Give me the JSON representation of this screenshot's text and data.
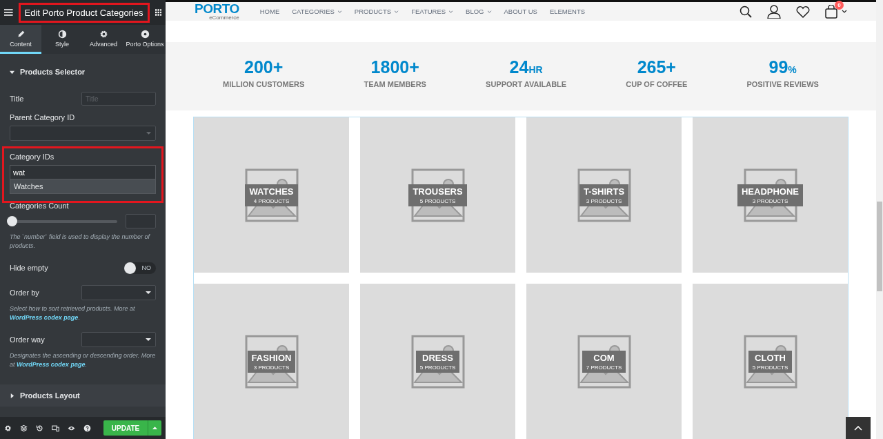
{
  "editor": {
    "title": "Edit Porto Product Categories",
    "tabs": [
      {
        "label": "Content",
        "selected": true
      },
      {
        "label": "Style",
        "selected": false
      },
      {
        "label": "Advanced",
        "selected": false
      },
      {
        "label": "Porto Options",
        "selected": false
      }
    ],
    "sections": [
      {
        "title": "Products Selector",
        "expanded": true,
        "controls": [
          {
            "kind": "text",
            "label": "Title",
            "placeholder": "Title"
          },
          {
            "kind": "select",
            "label": "Parent Category ID"
          },
          {
            "kind": "tags",
            "label": "Category IDs",
            "value": "wat",
            "suggestion": "Watches",
            "highlighted": true
          },
          {
            "kind": "slider",
            "label": "Categories Count",
            "level": 0
          },
          {
            "kind": "help",
            "text": "The `number` field is used to display the number of products."
          },
          {
            "kind": "toggle",
            "label": "Hide empty",
            "on": false,
            "off_text": "NO"
          },
          {
            "kind": "dropdown",
            "label": "Order by"
          },
          {
            "kind": "help",
            "text": "Select how to sort retrieved products. More at",
            "link": "WordPress codex page",
            "tail": "."
          },
          {
            "kind": "dropdown",
            "label": "Order way"
          },
          {
            "kind": "help",
            "text": "Designates the ascending or descending order. More at",
            "link": "WordPress codex page",
            "tail": "."
          }
        ]
      },
      {
        "title": "Products Layout",
        "expanded": false
      }
    ],
    "footer": {
      "button": "UPDATE"
    }
  },
  "site": {
    "logo": {
      "name": "PORTO",
      "tagline": "eCommerce"
    },
    "nav": [
      {
        "label": "HOME",
        "dropdown": false
      },
      {
        "label": "CATEGORIES",
        "dropdown": true
      },
      {
        "label": "PRODUCTS",
        "dropdown": true
      },
      {
        "label": "FEATURES",
        "dropdown": true
      },
      {
        "label": "BLOG",
        "dropdown": true
      },
      {
        "label": "ABOUT US",
        "dropdown": false
      },
      {
        "label": "ELEMENTS",
        "dropdown": false
      }
    ],
    "cart_count": "0",
    "stats": [
      {
        "number": "200+",
        "label": "MILLION CUSTOMERS"
      },
      {
        "number": "1800+",
        "label": "TEAM MEMBERS"
      },
      {
        "number": "24",
        "unit": "HR",
        "label": "SUPPORT AVAILABLE"
      },
      {
        "number": "265+",
        "label": "CUP OF COFFEE"
      },
      {
        "number": "99",
        "unit": "%",
        "label": "POSITIVE REVIEWS"
      }
    ],
    "categories": [
      {
        "name": "WATCHES",
        "count": "4 PRODUCTS"
      },
      {
        "name": "TROUSERS",
        "count": "5 PRODUCTS"
      },
      {
        "name": "T-SHIRTS",
        "count": "3 PRODUCTS"
      },
      {
        "name": "HEADPHONE",
        "count": "3 PRODUCTS"
      },
      {
        "name": "FASHION",
        "count": "3 PRODUCTS"
      },
      {
        "name": "DRESS",
        "count": "5 PRODUCTS"
      },
      {
        "name": "COM",
        "count": "7 PRODUCTS"
      },
      {
        "name": "CLOTH",
        "count": "5 PRODUCTS"
      }
    ]
  }
}
